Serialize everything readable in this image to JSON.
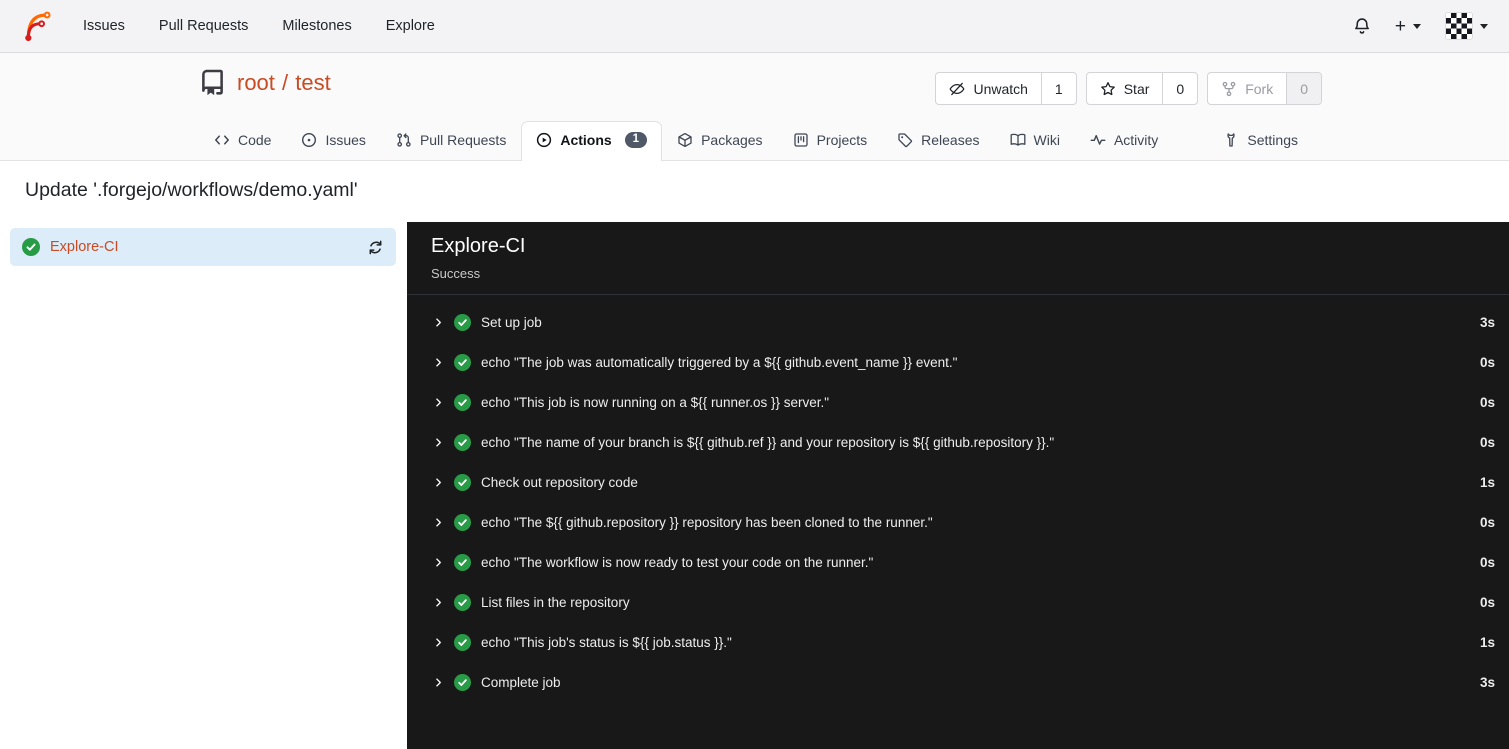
{
  "colors": {
    "accent_link": "#c84b23",
    "success_green": "#279b45",
    "panel_background": "#181818",
    "selected_job_background": "#dcedf9",
    "badge_background": "#4e5866"
  },
  "navbar": {
    "logo_icon": "forgejo-logo",
    "items": [
      {
        "label": "Issues"
      },
      {
        "label": "Pull Requests"
      },
      {
        "label": "Milestones"
      },
      {
        "label": "Explore"
      }
    ],
    "right": {
      "bell_icon": "bell-icon",
      "create_label": "+",
      "caret_icon": "caret-down-icon",
      "avatar_icon": "identicon-avatar"
    }
  },
  "repo_header": {
    "repo_icon": "repo-book-icon",
    "owner": "root",
    "separator": "/",
    "name": "test",
    "actions": [
      {
        "icon": "eye-slash-icon",
        "label": "Unwatch",
        "count": "1",
        "disabled": false
      },
      {
        "icon": "star-icon",
        "label": "Star",
        "count": "0",
        "disabled": false
      },
      {
        "icon": "fork-icon",
        "label": "Fork",
        "count": "0",
        "disabled": true
      }
    ],
    "tabs": [
      {
        "icon": "code-icon",
        "label": "Code",
        "active": false
      },
      {
        "icon": "issue-circle-icon",
        "label": "Issues",
        "active": false
      },
      {
        "icon": "pull-request-icon",
        "label": "Pull Requests",
        "active": false
      },
      {
        "icon": "play-circle-icon",
        "label": "Actions",
        "badge": "1",
        "active": true
      },
      {
        "icon": "package-icon",
        "label": "Packages",
        "active": false
      },
      {
        "icon": "project-board-icon",
        "label": "Projects",
        "active": false
      },
      {
        "icon": "tag-icon",
        "label": "Releases",
        "active": false
      },
      {
        "icon": "book-open-icon",
        "label": "Wiki",
        "active": false
      },
      {
        "icon": "pulse-icon",
        "label": "Activity",
        "active": false
      }
    ],
    "settings_tab": {
      "icon": "wrench-icon",
      "label": "Settings"
    }
  },
  "run": {
    "title": "Update '.forgejo/workflows/demo.yaml'",
    "jobs": [
      {
        "status_icon": "check-circle-icon",
        "name": "Explore-CI",
        "refresh_icon": "refresh-icon",
        "selected": true
      }
    ],
    "job_detail": {
      "name": "Explore-CI",
      "status": "Success",
      "steps": [
        {
          "name": "Set up job",
          "duration": "3s"
        },
        {
          "name": "echo \"The job was automatically triggered by a ${{ github.event_name }} event.\"",
          "duration": "0s"
        },
        {
          "name": "echo \"This job is now running on a ${{ runner.os }} server.\"",
          "duration": "0s"
        },
        {
          "name": "echo \"The name of your branch is ${{ github.ref }} and your repository is ${{ github.repository }}.\"",
          "duration": "0s"
        },
        {
          "name": "Check out repository code",
          "duration": "1s"
        },
        {
          "name": "echo \"The ${{ github.repository }} repository has been cloned to the runner.\"",
          "duration": "0s"
        },
        {
          "name": "echo \"The workflow is now ready to test your code on the runner.\"",
          "duration": "0s"
        },
        {
          "name": "List files in the repository",
          "duration": "0s"
        },
        {
          "name": "echo \"This job's status is ${{ job.status }}.\"",
          "duration": "1s"
        },
        {
          "name": "Complete job",
          "duration": "3s"
        }
      ]
    }
  }
}
